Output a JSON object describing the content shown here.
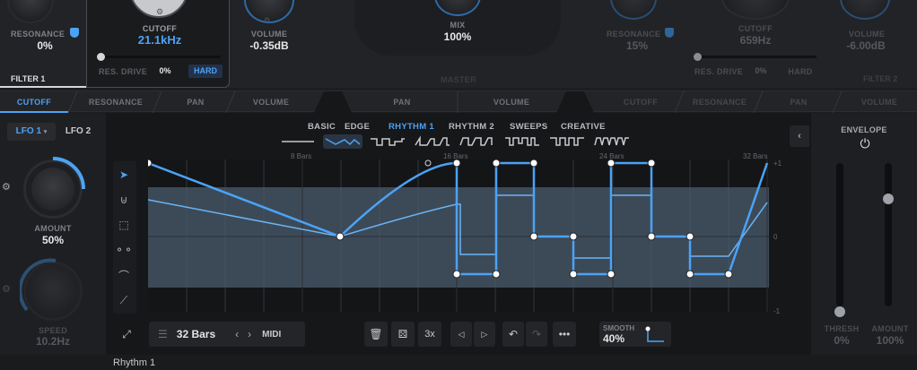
{
  "top": {
    "filter1": {
      "resonance_label": "RESONANCE",
      "resonance_value": "0%",
      "cutoff_label": "CUTOFF",
      "cutoff_value": "21.1kHz",
      "volume_label": "VOLUME",
      "volume_value": "-0.35dB",
      "res_drive_label": "RES. DRIVE",
      "res_drive_value": "0%",
      "mode": "HARD",
      "tab_label": "FILTER 1"
    },
    "mix_label": "MIX",
    "mix_value": "100%",
    "master_label": "MASTER",
    "filter2": {
      "resonance_label": "RESONANCE",
      "resonance_value": "15%",
      "cutoff_label": "CUTOFF",
      "cutoff_value": "659Hz",
      "volume_label": "VOLUME",
      "volume_value": "-6.00dB",
      "res_drive_label": "RES. DRIVE",
      "res_drive_value": "0%",
      "mode": "HARD",
      "tab_label": "FILTER 2"
    }
  },
  "tabs": [
    "CUTOFF",
    "RESONANCE",
    "PAN",
    "VOLUME",
    "PAN",
    "VOLUME",
    "CUTOFF",
    "RESONANCE",
    "PAN",
    "VOLUME"
  ],
  "lfo": {
    "tab1": "LFO 1",
    "tab2": "LFO 2",
    "amount_label": "AMOUNT",
    "amount_value": "50%",
    "amount_level": 0.5,
    "speed_label": "SPEED",
    "speed_value": "10.2Hz"
  },
  "presets": {
    "categories": [
      "BASIC",
      "EDGE",
      "RHYTHM 1",
      "RHYTHM 2",
      "SWEEPS",
      "CREATIVE"
    ],
    "active": "RHYTHM 1"
  },
  "graph": {
    "bar_labels": [
      "8 Bars",
      "16 Bars",
      "24 Bars",
      "32 Bars"
    ],
    "y_labels": [
      "+1",
      "0",
      "-1"
    ]
  },
  "toolbar": {
    "length": "32 Bars",
    "midi": "MIDI",
    "multiplier": "3x",
    "smooth_label": "SMOOTH",
    "smooth_value": "40%"
  },
  "envelope": {
    "title": "ENVELOPE",
    "thresh_label": "THRESH",
    "thresh_value": "0%",
    "amount_label": "AMOUNT",
    "amount_value": "100%"
  },
  "status": "Rhythm 1",
  "colors": {
    "accent": "#4ba3f5",
    "background": "#1c1d20"
  }
}
